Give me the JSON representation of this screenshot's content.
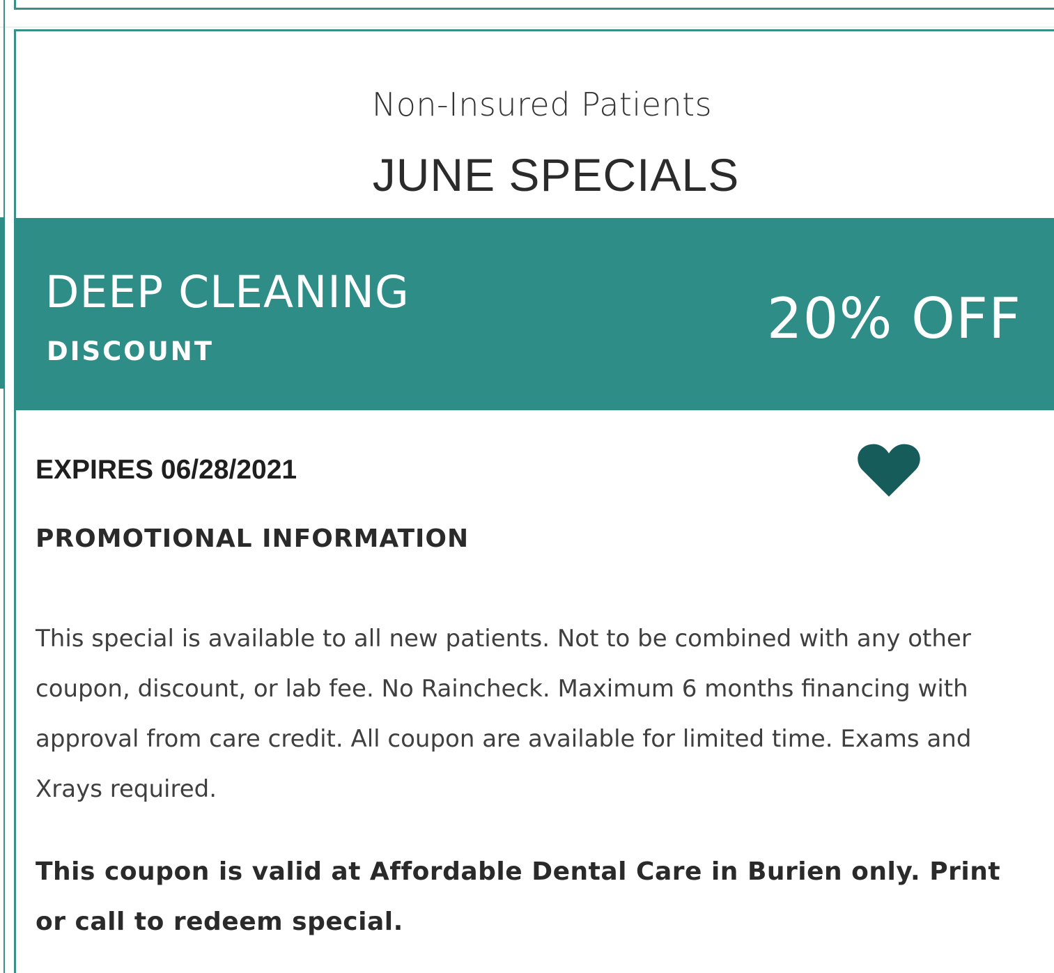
{
  "colors": {
    "accent": "#2f8d87",
    "border": "#3a8f88",
    "heart": "#165c5b",
    "text_dark": "#1f1f1f",
    "text_body": "#3f3f3f",
    "background": "#ffffff"
  },
  "header": {
    "subtitle": "Non-Insured Patients",
    "title": "JUNE SPECIALS"
  },
  "banner": {
    "service": "DEEP CLEANING",
    "type": "DISCOUNT",
    "offer": "20% OFF"
  },
  "details": {
    "expires": "EXPIRES 06/28/2021",
    "favorite_icon": "heart-icon",
    "promo_heading": "PROMOTIONAL INFORMATION",
    "promo_body": "This special is available to all new patients. Not to be combined with any other coupon, discount, or lab fee. No Raincheck. Maximum 6 months financing with approval from care credit. All coupon are available for limited time. Exams and Xrays required.",
    "validity": "This coupon is valid at Affordable Dental Care in Burien only. Print or call to redeem special."
  }
}
